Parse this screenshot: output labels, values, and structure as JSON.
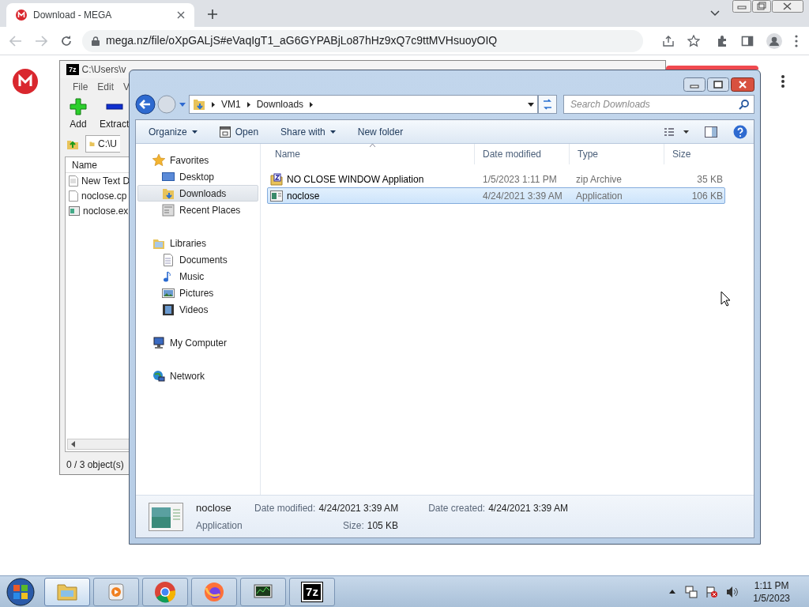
{
  "browser": {
    "tab_title": "Download - MEGA",
    "url": "mega.nz/file/oXpGALjS#eVaqIgT1_aG6GYPABjLo87hHz9xQ7c9ttMVHsuoyOIQ"
  },
  "sevenzip": {
    "logo": "7z",
    "title": "C:\\Users\\v",
    "menu": [
      "File",
      "Edit",
      "V"
    ],
    "toolbar": [
      {
        "kind": "add",
        "label": "Add"
      },
      {
        "kind": "extract",
        "label": "Extract"
      }
    ],
    "path": "C:\\U",
    "column": "Name",
    "files": [
      {
        "kind": "text",
        "name": "New Text D"
      },
      {
        "kind": "file",
        "name": "noclose.cp"
      },
      {
        "kind": "app",
        "name": "noclose.ex"
      }
    ],
    "status": "0 / 3 object(s)"
  },
  "explorer": {
    "breadcrumb": [
      "VM1",
      "Downloads"
    ],
    "search": {
      "placeholder": "Search Downloads"
    },
    "toolbar": [
      {
        "kind": "menu",
        "label": "Organize"
      },
      {
        "kind": "open",
        "label": "Open"
      },
      {
        "kind": "menu",
        "label": "Share with"
      },
      {
        "kind": "plain",
        "label": "New folder"
      }
    ],
    "nav": [
      {
        "kind": "star",
        "label": "Favorites",
        "selected": false,
        "children": [
          {
            "kind": "desktop",
            "label": "Desktop",
            "selected": false
          },
          {
            "kind": "downloads",
            "label": "Downloads",
            "selected": true
          },
          {
            "kind": "recent",
            "label": "Recent Places",
            "selected": false
          }
        ]
      },
      {
        "kind": "libraries",
        "label": "Libraries",
        "selected": false,
        "children": [
          {
            "kind": "documents",
            "label": "Documents",
            "selected": false
          },
          {
            "kind": "music",
            "label": "Music",
            "selected": false
          },
          {
            "kind": "pictures",
            "label": "Pictures",
            "selected": false
          },
          {
            "kind": "videos",
            "label": "Videos",
            "selected": false
          }
        ]
      },
      {
        "kind": "computer",
        "label": "My Computer",
        "selected": false
      },
      {
        "kind": "network",
        "label": "Network",
        "selected": false
      }
    ],
    "columns": [
      "Name",
      "Date modified",
      "Type",
      "Size"
    ],
    "rows": [
      {
        "kind": "zip",
        "name": "NO CLOSE WINDOW Appliation",
        "date": "1/5/2023 1:11 PM",
        "type": "zip Archive",
        "size": "35 KB",
        "selected": false
      },
      {
        "kind": "app",
        "name": "noclose",
        "date": "4/24/2021 3:39 AM",
        "type": "Application",
        "size": "106 KB",
        "selected": true
      }
    ],
    "details": {
      "name": "noclose",
      "type": "Application",
      "fields": [
        {
          "label": "Date modified:",
          "value": "4/24/2021 3:39 AM"
        },
        {
          "label": "Size:",
          "value": "105 KB"
        },
        {
          "label": "Date created:",
          "value": "4/24/2021 3:39 AM"
        }
      ]
    }
  },
  "taskbar": {
    "apps": [
      {
        "kind": "explorer",
        "selected": true
      },
      {
        "kind": "media",
        "selected": false
      },
      {
        "kind": "chrome",
        "selected": false
      },
      {
        "kind": "firefox",
        "selected": false
      },
      {
        "kind": "monitor",
        "selected": false
      },
      {
        "kind": "sevenzip",
        "label": "7z",
        "selected": false
      }
    ],
    "time": "1:11 PM",
    "date": "1/5/2023"
  }
}
